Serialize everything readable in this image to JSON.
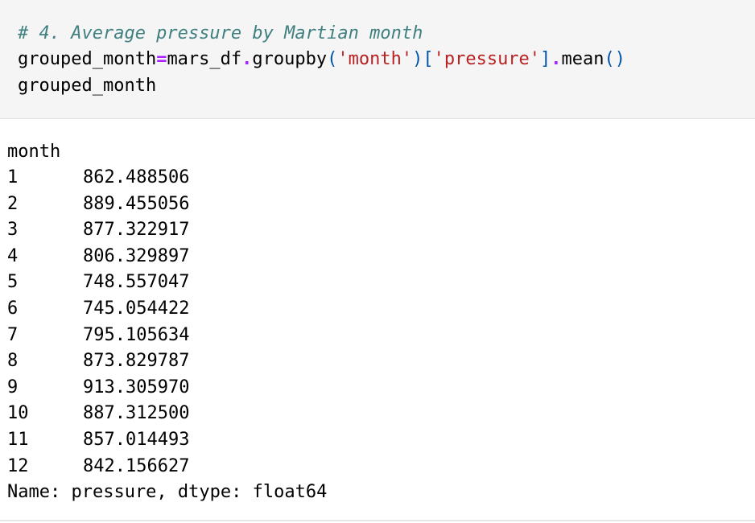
{
  "input": {
    "comment": "# 4. Average pressure by Martian month",
    "line2": {
      "var": "grouped_month",
      "eq": "=",
      "df": "mars_df",
      "dot1": ".",
      "method": "groupby",
      "p_open": "(",
      "arg": "'month'",
      "p_close": ")",
      "b_open": "[",
      "key": "'pressure'",
      "b_close": "]",
      "dot2": ".",
      "method2": "mean",
      "call": "()"
    },
    "line3": "grouped_month"
  },
  "output": {
    "header": "month",
    "rows": [
      {
        "month": "1",
        "value": "862.488506"
      },
      {
        "month": "2",
        "value": "889.455056"
      },
      {
        "month": "3",
        "value": "877.322917"
      },
      {
        "month": "4",
        "value": "806.329897"
      },
      {
        "month": "5",
        "value": "748.557047"
      },
      {
        "month": "6",
        "value": "745.054422"
      },
      {
        "month": "7",
        "value": "795.105634"
      },
      {
        "month": "8",
        "value": "873.829787"
      },
      {
        "month": "9",
        "value": "913.305970"
      },
      {
        "month": "10",
        "value": "887.312500"
      },
      {
        "month": "11",
        "value": "857.014493"
      },
      {
        "month": "12",
        "value": "842.156627"
      }
    ],
    "footer": "Name: pressure, dtype: float64"
  }
}
